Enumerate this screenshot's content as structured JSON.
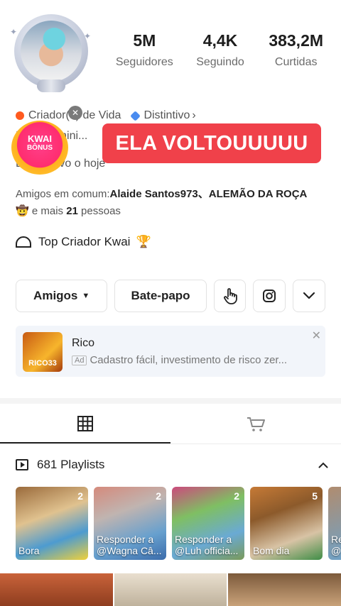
{
  "stats": [
    {
      "value": "5M",
      "label": "Seguidores"
    },
    {
      "value": "4,4K",
      "label": "Seguindo"
    },
    {
      "value": "383,2M",
      "label": "Curtidas"
    }
  ],
  "tags": {
    "creator": "Criador(a) de Vida",
    "badge": "Distintivo",
    "badge_chevron": "›"
  },
  "bio": {
    "line1": "Fa... feemini...",
    "line2": "E... as vivo o hoje"
  },
  "overlay": {
    "kwai_bonus_line1": "KWAI",
    "kwai_bonus_line2": "BÔNUS",
    "close": "✕",
    "banner": "ELA VOLTOUUUUU"
  },
  "mutual": {
    "prefix": "Amigos em comum:",
    "names": "Alaide Santos973、ALEMÃO DA ROÇA",
    "emoji": "🤠",
    "and_more": " e mais ",
    "count": "21",
    "suffix": " pessoas"
  },
  "top_creator": {
    "label": "Top Criador Kwai",
    "trophy": "🏆"
  },
  "actions": {
    "friends": "Amigos",
    "chat": "Bate-papo",
    "chevron": "⌄"
  },
  "ad": {
    "thumb_text": "RICO33",
    "title": "Rico",
    "tag": "Ad",
    "description": "Cadastro fácil, investimento de risco zer...",
    "close": "✕"
  },
  "playlists": {
    "header": "681 Playlists",
    "collapse": "⌃",
    "cards": [
      {
        "count": "2",
        "title": "Bora"
      },
      {
        "count": "2",
        "title": "Responder a @Wagna Câ..."
      },
      {
        "count": "2",
        "title": "Responder a @Luh officia..."
      },
      {
        "count": "5",
        "title": "Bom dia"
      },
      {
        "count": "",
        "title": "Re @"
      }
    ]
  }
}
